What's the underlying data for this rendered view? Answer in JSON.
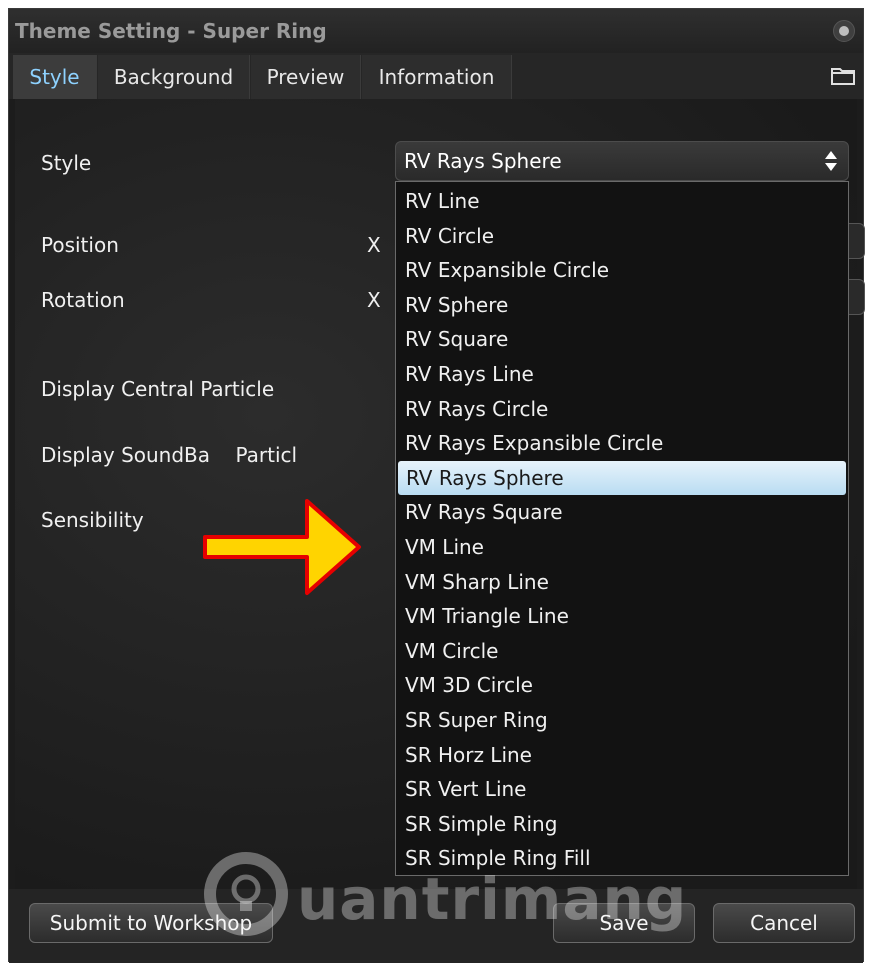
{
  "window": {
    "title": "Theme Setting - Super Ring"
  },
  "tabs": [
    {
      "label": "Style",
      "active": true
    },
    {
      "label": "Background",
      "active": false
    },
    {
      "label": "Preview",
      "active": false
    },
    {
      "label": "Information",
      "active": false
    }
  ],
  "form": {
    "style_label": "Style",
    "position_label": "Position",
    "rotation_label": "Rotation",
    "x_label": "X",
    "central_particle_label": "Display Central Particle",
    "soundbar_particle_label": "Display SoundBa    Particl",
    "sensibility_label": "Sensibility"
  },
  "style_select": {
    "value": "RV Rays Sphere",
    "options": [
      "RV Line",
      "RV Circle",
      "RV Expansible Circle",
      "RV Sphere",
      "RV Square",
      "RV Rays Line",
      "RV Rays Circle",
      "RV Rays Expansible Circle",
      "RV Rays Sphere",
      "RV Rays Square",
      "VM Line",
      "VM Sharp Line",
      "VM Triangle Line",
      "VM Circle",
      "VM 3D Circle",
      "SR Super Ring",
      "SR Horz Line",
      "SR Vert Line",
      "SR Simple Ring",
      "SR Simple Ring Fill"
    ],
    "selected_index": 8
  },
  "footer": {
    "workshop_label": "Submit to Workshop",
    "save_label": "Save",
    "cancel_label": "Cancel"
  },
  "watermark": {
    "text": "uantrimang"
  },
  "colors": {
    "window_bg": "#1c1c1c",
    "active_tab_text": "#8ed2ff",
    "selection_bg": "#cfe7f7",
    "arrow_fill": "#ffd400",
    "arrow_outline": "#e60000"
  },
  "icons": {
    "folder": "folder-icon",
    "close": "close-icon",
    "select_arrows": "up-down-arrows-icon",
    "pointer_arrow": "arrow-right-icon",
    "watermark_logo": "lightbulb-icon"
  }
}
